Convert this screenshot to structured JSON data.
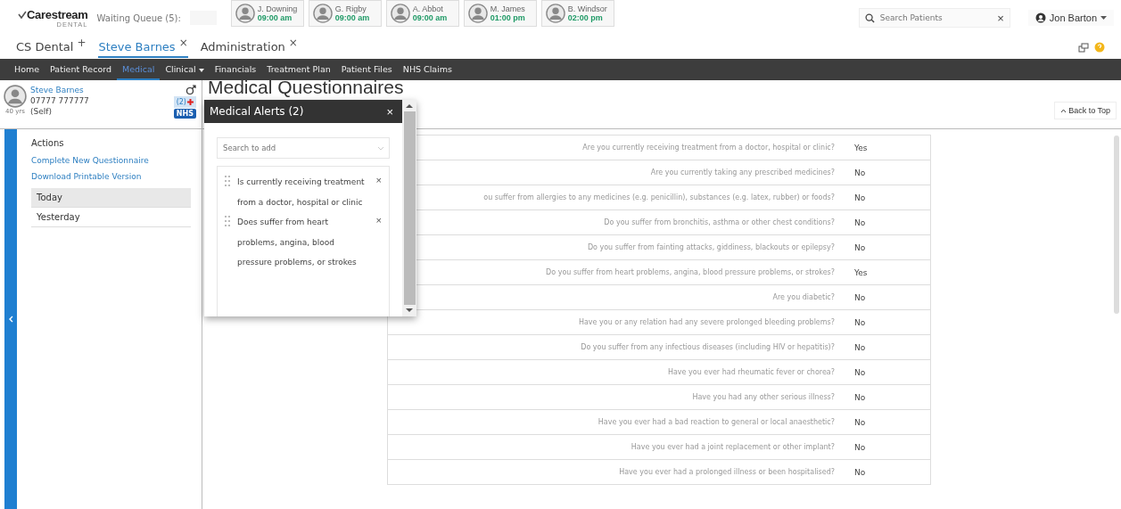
{
  "header": {
    "logo": "Carestream",
    "logo_sub": "DENTAL",
    "waiting_queue": "Waiting Queue (5):",
    "appointments": [
      {
        "name": "J. Downing",
        "time": "09:00 am"
      },
      {
        "name": "G. Rigby",
        "time": "09:00 am"
      },
      {
        "name": "A. Abbot",
        "time": "09:00 am"
      },
      {
        "name": "M. James",
        "time": "01:00 pm"
      },
      {
        "name": "B. Windsor",
        "time": "02:00 pm"
      }
    ],
    "search": {
      "placeholder": "Search Patients",
      "clear": "×"
    },
    "user": "Jon Barton"
  },
  "tabs": [
    {
      "label": "CS Dental",
      "action": "+",
      "selected": false
    },
    {
      "label": "Steve Barnes",
      "action": "×",
      "selected": true
    },
    {
      "label": "Administration",
      "action": "×",
      "selected": false
    }
  ],
  "nav": [
    {
      "label": "Home",
      "selected": false,
      "has_menu": false
    },
    {
      "label": "Patient Record",
      "selected": false,
      "has_menu": false
    },
    {
      "label": "Medical",
      "selected": true,
      "has_menu": false
    },
    {
      "label": "Clinical",
      "selected": false,
      "has_menu": true
    },
    {
      "label": "Financials",
      "selected": false,
      "has_menu": false
    },
    {
      "label": "Treatment Plan",
      "selected": false,
      "has_menu": false
    },
    {
      "label": "Patient Files",
      "selected": false,
      "has_menu": false
    },
    {
      "label": "NHS Claims",
      "selected": false,
      "has_menu": false
    }
  ],
  "patient": {
    "name": "Steve Barnes",
    "phone": "07777 777777",
    "age": "40 yrs",
    "relation": "(Self)",
    "alerts": "(2)",
    "badge": "NHS"
  },
  "actions": {
    "title": "Actions",
    "links": [
      "Complete New Questionnaire",
      "Download Printable Version"
    ],
    "dates": [
      {
        "label": "Today",
        "selected": true
      },
      {
        "label": "Yesterday",
        "selected": false
      }
    ]
  },
  "main": {
    "title": "Medical Questionnaires",
    "back_to_top": "Back to Top",
    "questions": [
      {
        "question": "Are you currently receiving treatment from a doctor, hospital or clinic?",
        "answer": "Yes"
      },
      {
        "question": "Are you currently taking any prescribed medicines?",
        "answer": "No"
      },
      {
        "question": "ou suffer from allergies to any medicines (e.g. penicillin), substances (e.g. latex, rubber) or foods?",
        "answer": "No"
      },
      {
        "question": "Do you suffer from bronchitis, asthma or other chest conditions?",
        "answer": "No"
      },
      {
        "question": "Do you suffer from fainting attacks, giddiness, blackouts or epilepsy?",
        "answer": "No"
      },
      {
        "question": "Do you suffer from heart problems, angina, blood pressure problems, or strokes?",
        "answer": "Yes"
      },
      {
        "question": "Are you diabetic?",
        "answer": "No"
      },
      {
        "question": "Have you or any relation had any severe prolonged bleeding problems?",
        "answer": "No"
      },
      {
        "question": "Do you suffer from any infectious diseases (including HIV or hepatitis)?",
        "answer": "No"
      },
      {
        "question": "Have you ever had rheumatic fever or chorea?",
        "answer": "No"
      },
      {
        "question": "Have you had any other serious illness?",
        "answer": "No"
      },
      {
        "question": "Have you ever had a bad reaction to general or local anaesthetic?",
        "answer": "No"
      },
      {
        "question": "Have you ever had a joint replacement or other implant?",
        "answer": "No"
      },
      {
        "question": "Have you ever had a prolonged illness or been hospitalised?",
        "answer": "No"
      }
    ]
  },
  "alerts_popup": {
    "title": "Medical Alerts (2)",
    "close": "×",
    "search": {
      "placeholder": "Search to add"
    },
    "items": [
      {
        "text": "Is currently receiving treatment from a doctor, hospital or clinic",
        "remove": "×"
      },
      {
        "text": "Does suffer from heart problems, angina, blood pressure problems, or strokes",
        "remove": "×"
      }
    ]
  }
}
